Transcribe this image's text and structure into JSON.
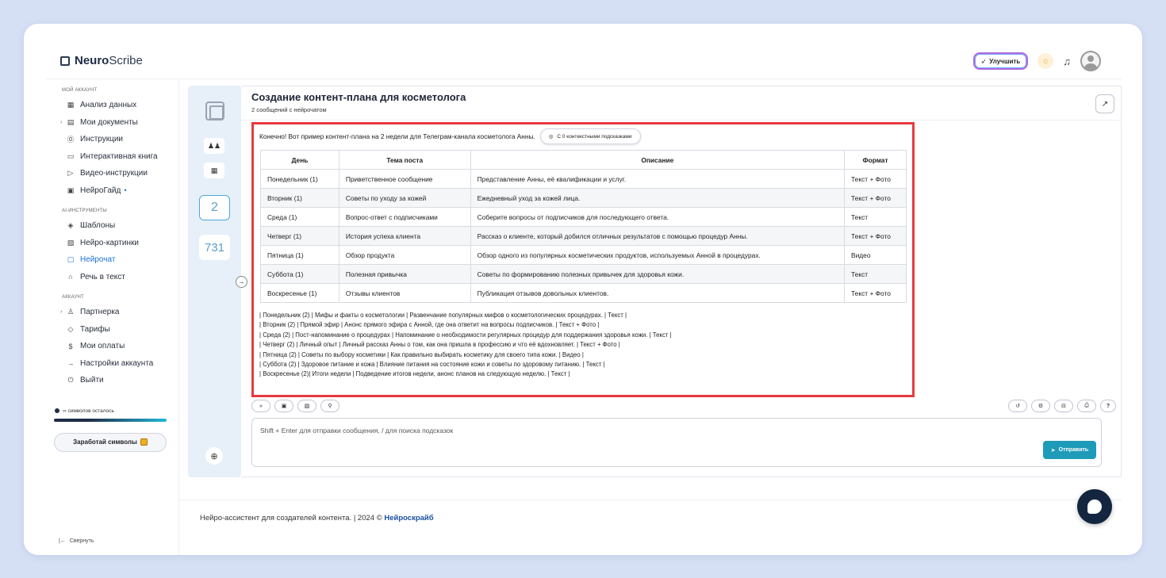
{
  "app": {
    "logo_bold": "Neuro",
    "logo_rest": "Scribe",
    "upgrade_label": "Улучшить"
  },
  "sidebar": {
    "section_account": "МОЙ АККАУНТ",
    "account_items": [
      {
        "label": "Анализ данных",
        "icon": "grid-icon"
      },
      {
        "label": "Мои документы",
        "icon": "document-icon"
      },
      {
        "label": "Инструкции",
        "icon": "help-circle-icon"
      },
      {
        "label": "Интерактивная книга",
        "icon": "book-icon"
      },
      {
        "label": "Видео-инструкции",
        "icon": "video-icon"
      },
      {
        "label": "НейроГайд",
        "icon": "guide-icon"
      }
    ],
    "section_ai": "AI-ИНСТРУМЕНТЫ",
    "ai_items": [
      {
        "label": "Шаблоны",
        "icon": "layers-icon"
      },
      {
        "label": "Нейро-картинки",
        "icon": "image-icon"
      },
      {
        "label": "Нейрочат",
        "icon": "chat-icon"
      },
      {
        "label": "Речь в текст",
        "icon": "headphones-icon"
      }
    ],
    "section_acc": "АККАУНТ",
    "acc_items": [
      {
        "label": "Партнерка",
        "icon": "users-icon"
      },
      {
        "label": "Тарифы",
        "icon": "tag-icon"
      },
      {
        "label": "Мои оплаты",
        "icon": "dollar-icon"
      },
      {
        "label": "Настройки аккаунта",
        "icon": "login-icon"
      },
      {
        "label": "Выйти",
        "icon": "power-icon"
      }
    ],
    "symbols_left": "∞ символов осталось",
    "earn_label": "Заработай символы",
    "collapse_label": "Свернуть"
  },
  "leftcol": {
    "count_messages": "2",
    "count_other": "731"
  },
  "chat": {
    "title": "Создание контент-плана для косметолога",
    "subtitle": "2 сообщений с нейрочатом",
    "intro": "Конечно! Вот пример контент-плана на 2 недели для Телеграм-канала косметолога Анны.",
    "context_pill": "С 0 контекстными подсказками",
    "table_headers": [
      "День",
      "Тема поста",
      "Описание",
      "Формат"
    ],
    "table_rows": [
      [
        "Понедельник (1)",
        "Приветственное сообщение",
        "Представление Анны, её квалификации и услуг.",
        "Текст + Фото"
      ],
      [
        "Вторник (1)",
        "Советы по уходу за кожей",
        "Ежедневный уход за кожей лица.",
        "Текст + Фото"
      ],
      [
        "Среда (1)",
        "Вопрос-ответ с подписчиками",
        "Соберите вопросы от подписчиков для последующего ответа.",
        "Текст"
      ],
      [
        "Четверг (1)",
        "История успеха клиента",
        "Рассказ о клиенте, который добился отличных результатов с помощью процедур Анны.",
        "Текст + Фото"
      ],
      [
        "Пятница (1)",
        "Обзор продукта",
        "Обзор одного из популярных косметических продуктов, используемых Анной в процедурах.",
        "Видео"
      ],
      [
        "Суббота (1)",
        "Полезная привычка",
        "Советы по формированию полезных привычек для здоровья кожи.",
        "Текст"
      ],
      [
        "Воскресенье (1)",
        "Отзывы клиентов",
        "Публикация отзывов довольных клиентов.",
        "Текст + Фото"
      ]
    ],
    "raw_lines": [
      "| Понедельник (2) | Мифы и факты о косметологии | Развенчание популярных мифов о косметологических процедурах. | Текст |",
      "| Вторник (2) | Прямой эфир | Анонс прямого эфира с Анной, где она ответит на вопросы подписчиков. | Текст + Фото |",
      "| Среда (2) | Пост-напоминание о процедурах | Напоминание о необходимости регулярных процедур для поддержания здоровья кожи. | Текст |",
      "| Четверг (2) | Личный опыт | Личный рассказ Анны о том, как она пришла в профессию и что её вдохновляет. | Текст + Фото |",
      "| Пятница (2) | Советы по выбору косметики | Как правильно выбирать косметику для своего типа кожи. | Видео |",
      "| Суббота (2) | Здоровое питание и кожа | Влияние питания на состояние кожи и советы по здоровому питанию. | Текст |",
      "| Воскресенье (2)| Итоги недели | Подведение итогов недели, анонс планов на следующую неделю. | Текст |"
    ],
    "input_placeholder": "Shift + Enter для отправки сообщения, / для поиска подсказок",
    "send_label": "Отправить"
  },
  "footer": {
    "text": "Нейро-ассистент для создателей контента.  | 2024 © ",
    "brand": "Нейроскрайб"
  }
}
